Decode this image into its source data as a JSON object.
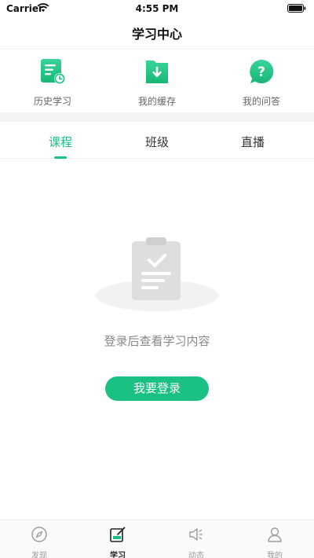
{
  "status_bar": {
    "carrier": "Carrier",
    "time": "4:55 PM"
  },
  "header": {
    "title": "学习中心"
  },
  "quick_actions": [
    {
      "label": "历史学习",
      "icon": "history-icon"
    },
    {
      "label": "我的缓存",
      "icon": "download-folder-icon"
    },
    {
      "label": "我的问答",
      "icon": "question-bubble-icon"
    }
  ],
  "tabs": [
    {
      "label": "课程",
      "active": true
    },
    {
      "label": "班级",
      "active": false
    },
    {
      "label": "直播",
      "active": false
    }
  ],
  "empty_state": {
    "message": "登录后查看学习内容",
    "button_label": "我要登录"
  },
  "tab_bar": [
    {
      "label": "发现",
      "icon": "compass-icon",
      "active": false
    },
    {
      "label": "学习",
      "icon": "study-icon",
      "active": true
    },
    {
      "label": "动态",
      "icon": "speaker-icon",
      "active": false
    },
    {
      "label": "我的",
      "icon": "profile-icon",
      "active": false
    }
  ],
  "colors": {
    "accent": "#1bc183",
    "accent_light": "#3ad39a",
    "text_muted": "#888888"
  }
}
